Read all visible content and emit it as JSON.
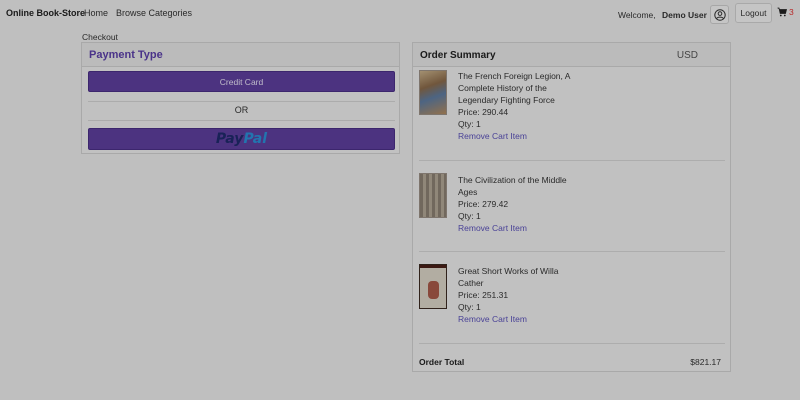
{
  "navbar": {
    "brand": "Online Book-Store",
    "home": "Home",
    "browse": "Browse Categories",
    "welcome_prefix": "Welcome,",
    "user_name": "Demo User",
    "logout": "Logout",
    "cart_count": "3"
  },
  "breadcrumb": {
    "checkout": "Checkout"
  },
  "payment": {
    "title": "Payment Type",
    "credit_card": "Credit Card",
    "or": "OR",
    "paypal_part1": "Pay",
    "paypal_part2": "Pal"
  },
  "summary": {
    "title": "Order Summary",
    "currency": "USD",
    "items": [
      {
        "title": "The French Foreign Legion, A Complete History of the Legendary Fighting Force",
        "price": "Price: 290.44",
        "qty": "Qty: 1",
        "remove": "Remove Cart Item"
      },
      {
        "title": "The Civilization of the Middle Ages",
        "price": "Price: 279.42",
        "qty": "Qty: 1",
        "remove": "Remove Cart Item"
      },
      {
        "title": "Great Short Works of Willa Cather",
        "price": "Price: 251.31",
        "qty": "Qty: 1",
        "remove": "Remove Cart Item"
      }
    ],
    "total_label": "Order Total",
    "total_value": "$821.17"
  },
  "colors": {
    "accent": "#5d3f9d",
    "heading_accent": "#5b3fa8",
    "link": "#5a50b8",
    "cart_badge": "#e03030"
  }
}
